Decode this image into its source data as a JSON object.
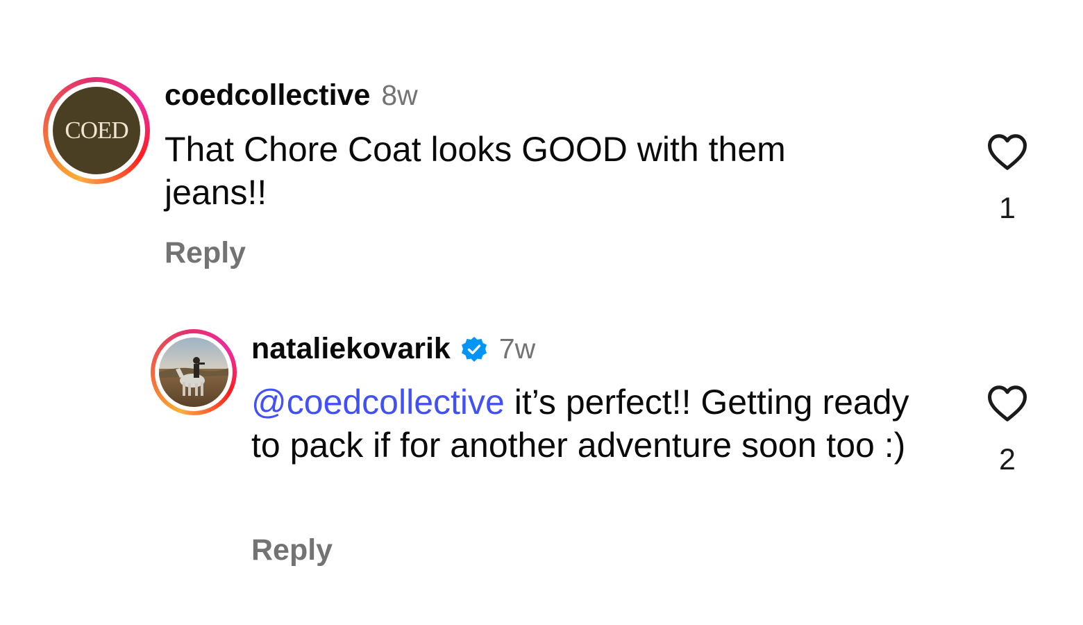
{
  "comments": [
    {
      "avatar_icon": "coed-logo",
      "avatar_text": "COED",
      "username": "coedcollective",
      "verified": false,
      "timestamp": "8w",
      "text": "That Chore Coat looks GOOD with them jeans!!",
      "reply_label": "Reply",
      "like_icon": "heart-outline-icon",
      "like_count": "1"
    },
    {
      "avatar_icon": "horse-rider-photo",
      "username": "nataliekovarik",
      "verified": true,
      "verified_icon": "verified-badge-icon",
      "timestamp": "7w",
      "mention": "@coedcollective",
      "text": " it’s perfect!! Getting ready to pack if for another adventure soon too :)",
      "reply_label": "Reply",
      "like_icon": "heart-outline-icon",
      "like_count": "2"
    }
  ],
  "colors": {
    "mention": "#4150f7",
    "verified": "#0095f6",
    "muted": "#737373",
    "coed_bg": "#4a3f22"
  }
}
